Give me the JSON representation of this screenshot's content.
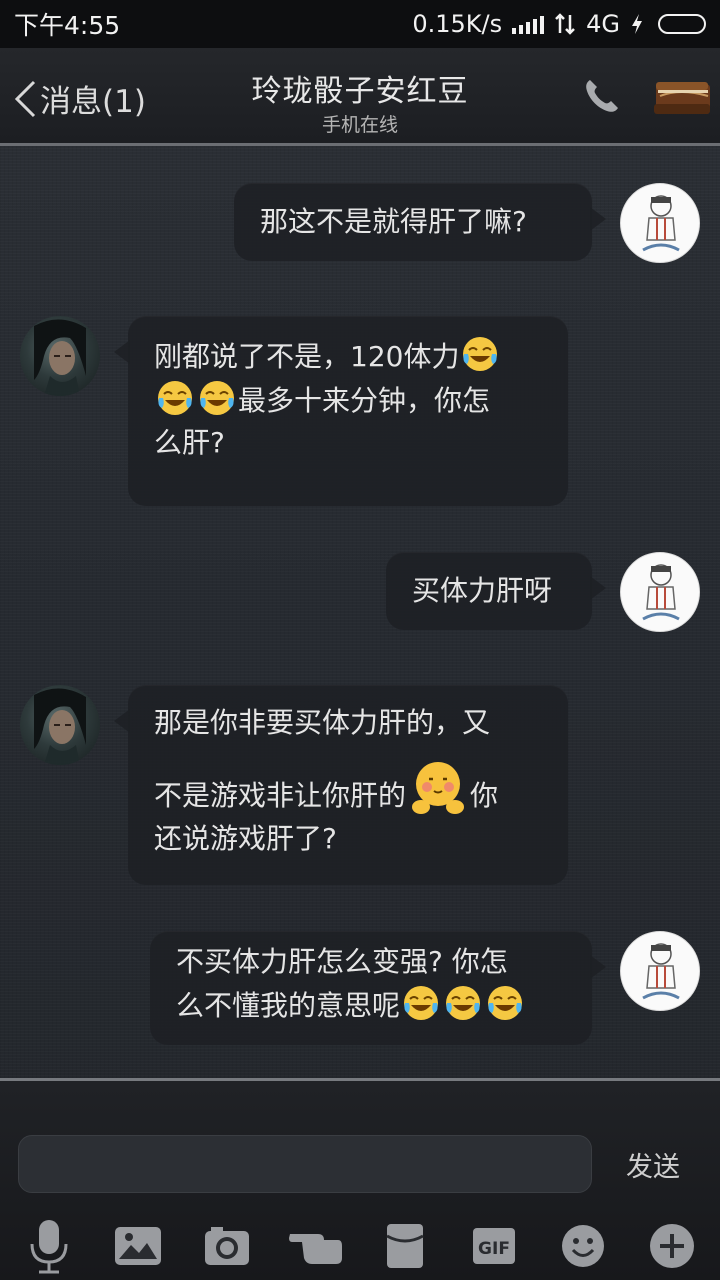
{
  "status_bar": {
    "time": "下午4:55",
    "speed": "0.15K/s",
    "network": "4G"
  },
  "header": {
    "back_label": "消息(1)",
    "title": "玲珑骰子安红豆",
    "subtitle": "手机在线"
  },
  "messages": [
    {
      "side": "right",
      "text": "那这不是就得肝了嘛?"
    },
    {
      "side": "left",
      "line1": "刚都说了不是，120体力",
      "line2": "最多十来分钟，你怎",
      "line3": "么肝?"
    },
    {
      "side": "right",
      "text": "买体力肝呀"
    },
    {
      "side": "left",
      "line1": "那是你非要买体力肝的，又",
      "line2a": "不是游戏非让你肝的",
      "line2b": "你",
      "line3": "还说游戏肝了?"
    },
    {
      "side": "right",
      "line1": "不买体力肝怎么变强? 你怎",
      "line2": "么不懂我的意思呢"
    }
  ],
  "input": {
    "send_label": "发送",
    "value": ""
  },
  "icons": [
    "mic-icon",
    "picture-icon",
    "camera-icon",
    "poke-icon",
    "red-packet-icon",
    "gif-icon",
    "emoji-icon",
    "plus-icon"
  ],
  "gif_label": "GIF"
}
